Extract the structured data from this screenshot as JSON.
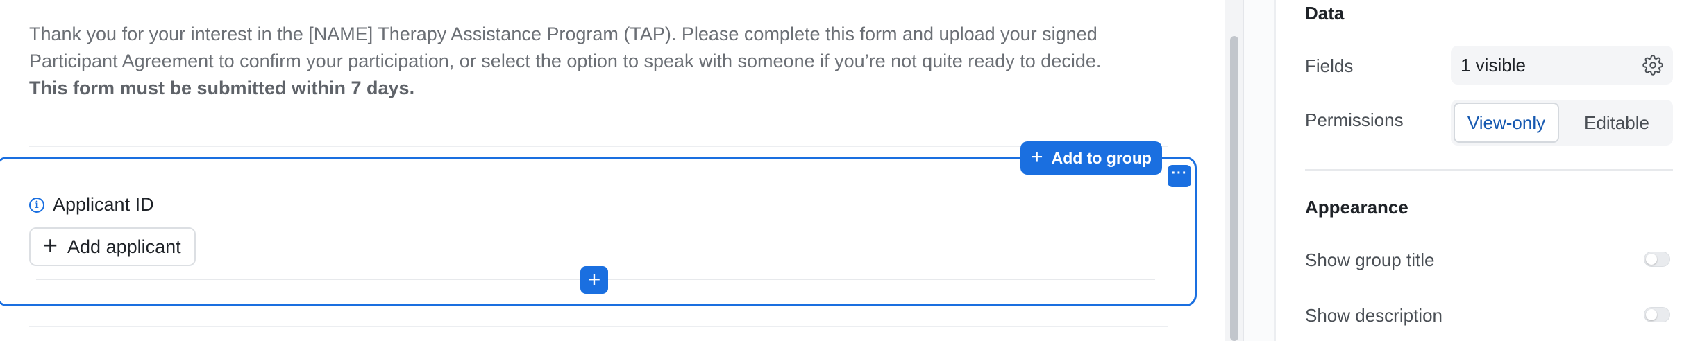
{
  "form": {
    "intro_text": "Thank you for your interest in the [NAME] Therapy Assistance Program (TAP). Please complete this form and upload your signed Participant Agreement to confirm your participation, or select the option to speak with someone if you’re not quite ready to decide.",
    "deadline_text": "This form must be submitted within 7 days.",
    "group": {
      "add_to_group_label": "Add to group",
      "more_label": "···",
      "field_label": "Applicant ID",
      "add_applicant_label": "Add applicant",
      "info_icon": "info-icon",
      "add_block_icon": "plus-icon"
    }
  },
  "panel": {
    "data_title": "Data",
    "fields_label": "Fields",
    "fields_value": "1 visible",
    "fields_icon": "gear-icon",
    "permissions_label": "Permissions",
    "permission_options": [
      "View-only",
      "Editable"
    ],
    "permission_selected": "View-only",
    "appearance_title": "Appearance",
    "show_group_title_label": "Show group title",
    "show_group_title_on": false,
    "show_description_label": "Show description",
    "show_description_on": false
  },
  "colors": {
    "accent": "#1a6fe0",
    "selected_text": "#1558b0",
    "muted_text": "#6b6f75"
  }
}
